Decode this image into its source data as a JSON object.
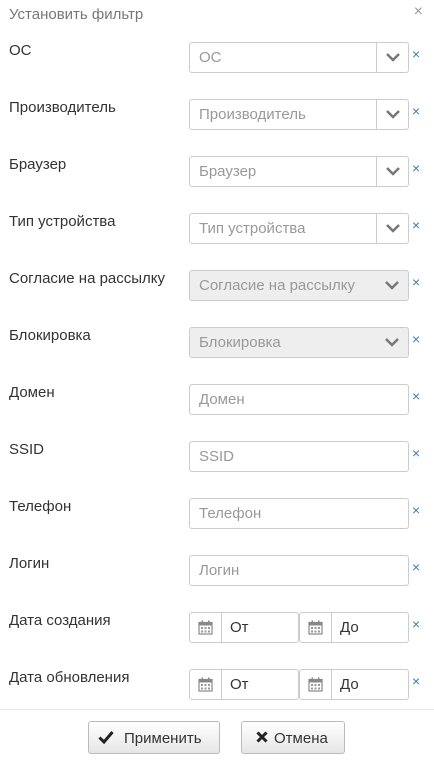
{
  "dialog": {
    "title": "Установить фильтр",
    "close_glyph": "×"
  },
  "fields": [
    {
      "label": "ОС",
      "placeholder": "ОС",
      "type": "select",
      "disabled": false
    },
    {
      "label": "Производитель",
      "placeholder": "Производитель",
      "type": "select",
      "disabled": false
    },
    {
      "label": "Браузер",
      "placeholder": "Браузер",
      "type": "select",
      "disabled": false
    },
    {
      "label": "Тип устройства",
      "placeholder": "Тип устройства",
      "type": "select",
      "disabled": false
    },
    {
      "label": "Согласие на рассылку",
      "placeholder": "Согласие на рассылку",
      "type": "select",
      "disabled": true
    },
    {
      "label": "Блокировка",
      "placeholder": "Блокировка",
      "type": "select",
      "disabled": true
    },
    {
      "label": "Домен",
      "placeholder": "Домен",
      "type": "text"
    },
    {
      "label": "SSID",
      "placeholder": "SSID",
      "type": "text"
    },
    {
      "label": "Телефон",
      "placeholder": "Телефон",
      "type": "text"
    },
    {
      "label": "Логин",
      "placeholder": "Логин",
      "type": "text"
    },
    {
      "label": "Дата создания",
      "from_placeholder": "От",
      "to_placeholder": "До",
      "type": "daterange"
    },
    {
      "label": "Дата обновления",
      "from_placeholder": "От",
      "to_placeholder": "До",
      "type": "daterange"
    }
  ],
  "clear_glyph": "×",
  "buttons": {
    "apply_label": "Применить",
    "cancel_label": "Отмена"
  },
  "colors": {
    "clear_icon": "#3a7fc1",
    "disabled_select_bg": "#eeeeee",
    "border": "#cccccc"
  },
  "icons": {
    "dropdown": "chevron-down-icon",
    "calendar": "calendar-icon",
    "apply": "check-icon",
    "cancel": "times-icon",
    "clear": "clear-icon"
  }
}
